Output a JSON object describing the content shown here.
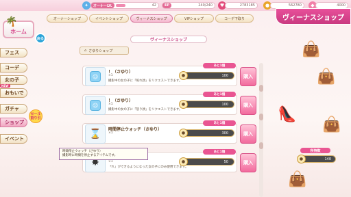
{
  "topbar": {
    "owner_lv_label": "オーナーLV.",
    "owner_lv_value": "42",
    "owner_lv_progress": 0.35,
    "ep_label": "EP",
    "ep_value": "240/240",
    "currency1": "2783185",
    "currency2": "562780",
    "currency3": "4000"
  },
  "header": {
    "title": "ヴィーナスショップ",
    "tabs": [
      "オーナーショップ",
      "イベントショップ",
      "ヴィーナスショップ",
      "VIPショップ",
      "コーデ下取り"
    ]
  },
  "sidebar": {
    "home": "ホーム",
    "back": "戻る",
    "new_tag": "NEW",
    "sale_tag": "セール\n割り引",
    "items": [
      "フェス",
      "コーデ",
      "女の子",
      "おもいで",
      "ガチャ",
      "ショップ",
      "イベント"
    ]
  },
  "panel": {
    "title": "ヴィーナスショップ",
    "shop_tab": "さゆりショップ"
  },
  "items": [
    {
      "name": "！（さゆり）",
      "qty": "×1",
      "desc": "撮影中の女の子に「照れ顔」をリクエストできます。",
      "remain": "あと1個",
      "price": "100",
      "buy": "購入"
    },
    {
      "name": "！（さゆり）",
      "qty": "×1",
      "desc": "撮影中の女の子に「怒り顔」をリクエストできます。",
      "remain": "あと1個",
      "price": "100",
      "buy": "購入"
    },
    {
      "name": "時間停止ウォッチ（さゆり）",
      "qty": "×1",
      "desc": "",
      "remain": "あと1個",
      "price": "300",
      "buy": "購入"
    },
    {
      "name": "",
      "qty": "×1",
      "desc": "「れ」ができるようになった女の子にのみ使用できます。",
      "remain": "あと1個",
      "price": "50",
      "buy": "購入"
    }
  ],
  "tooltip": {
    "line1": "時間停止ウォッチ（さゆり）",
    "line2": "撮影時に時間を停止するアイテムです。"
  },
  "coin_panel": {
    "title": "所持数",
    "value": "140"
  },
  "colors": {
    "accent": "#e95592",
    "buy_button": "#f26a9d",
    "price_bg": "#4b4b4b"
  }
}
